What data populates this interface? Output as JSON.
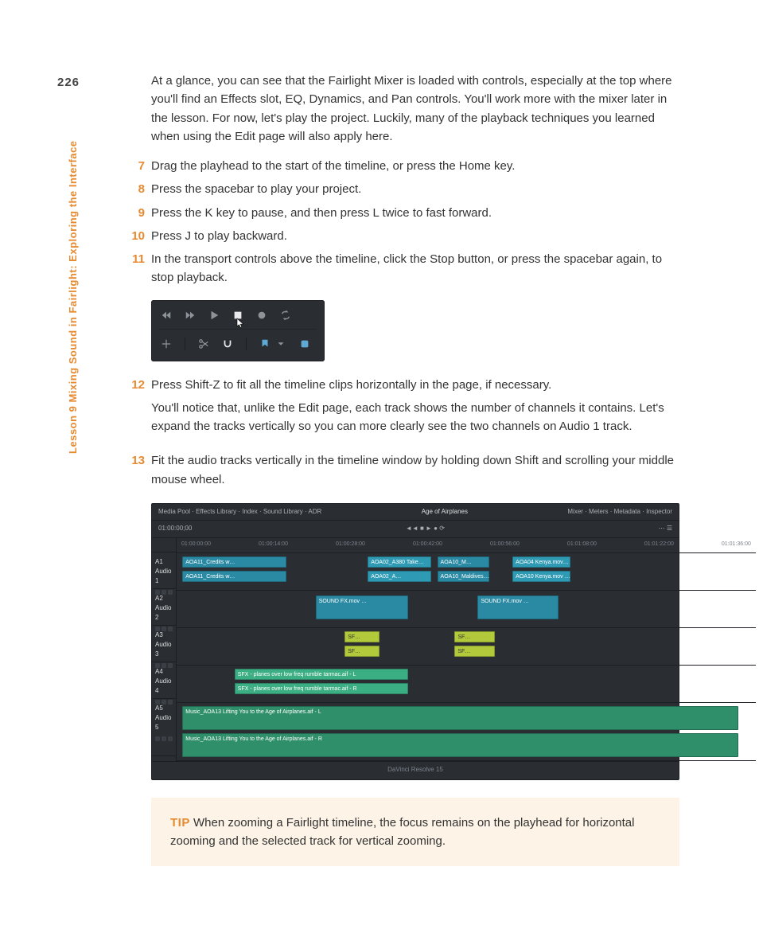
{
  "page_number": "226",
  "side_label": "Lesson 9   Mixing Sound in Fairlight: Exploring the Interface",
  "intro": "At a glance, you can see that the Fairlight Mixer is loaded with controls, especially at the top where you'll find an Effects slot, EQ, Dynamics, and Pan controls. You'll work more with the mixer later in the lesson. For now, let's play the project. Luckily, many of the playback techniques you learned when using the Edit page will also apply here.",
  "steps": {
    "s7": {
      "n": "7",
      "t": "Drag the playhead to the start of the timeline, or press the Home key."
    },
    "s8": {
      "n": "8",
      "t": "Press the spacebar to play your project."
    },
    "s9": {
      "n": "9",
      "t": "Press the K key to pause, and then press L twice to fast forward."
    },
    "s10": {
      "n": "10",
      "t": "Press J to play backward."
    },
    "s11": {
      "n": "11",
      "t": "In the transport controls above the timeline, click the Stop button, or press the spacebar again, to stop playback."
    },
    "s12": {
      "n": "12",
      "t": "Press Shift-Z to fit all the timeline clips horizontally in the page, if necessary."
    },
    "s12after": "You'll notice that, unlike the Edit page, each track shows the number of channels it contains. Let's expand the tracks vertically so you can more clearly see the two channels on Audio 1 track.",
    "s13": {
      "n": "13",
      "t": "Fit the audio tracks vertically in the timeline window by holding down Shift and scrolling your middle mouse wheel."
    }
  },
  "transport_icons": {
    "rewind": "rewind-icon",
    "ff": "fast-forward-icon",
    "play": "play-icon",
    "stop": "stop-icon",
    "record": "record-icon",
    "loop": "loop-icon",
    "crosshair": "crosshair-icon",
    "scissors": "scissors-icon",
    "magnet": "snap-icon",
    "flag": "marker-icon",
    "chev": "chevron-down-icon",
    "flagfill": "marker-fill-icon"
  },
  "timeline": {
    "title": "Age of Airplanes",
    "left_menu": "Media Pool  ·  Effects Library  ·  Index  ·  Sound Library  ·  ADR",
    "right_menu": "Mixer  ·  Meters  ·  Metadata  ·  Inspector",
    "timecode": "01:00:00;00",
    "tracks": {
      "a1": "A1   Audio 1",
      "a2": "A2   Audio 2",
      "a3": "A3   Audio 3",
      "a4": "A4   Audio 4",
      "a5": "A5   Audio 5"
    },
    "ruler": [
      "01:00:00:00",
      "01:00:14:00",
      "01:00:28:00",
      "01:00:42:00",
      "01:00:56:00",
      "01:01:08:00",
      "01:01:22:00",
      "01:01:36:00"
    ],
    "clips": {
      "c1": "AOA11_Credits w…",
      "c2": "AOA11_Credits w…",
      "c3": "AOA02_A380 Take…",
      "c4": "AOA02_A…",
      "c5": "AOA10_M…",
      "c6": "AOA10_Maldives…",
      "c7": "AOA04 Kenya.mov…",
      "c8": "AOA10 Kenya.mov …",
      "c9": "SOUND FX.mov …",
      "c10": "SOUND FX.mov …",
      "c11": "SF…",
      "c12": "SF…",
      "c13": "SF…",
      "c14": "SF…",
      "c15": "SFX - planes over low freq rumble tarmac.aif - L",
      "c16": "SFX - planes over low freq rumble tarmac.aif - R",
      "c17": "Music_AOA13 Lifting You to the Age of Airplanes.aif - L",
      "c18": "Music_AOA13 Lifting You to the Age of Airplanes.aif - R"
    },
    "footer": "DaVinci Resolve 15"
  },
  "tip": {
    "label": "TIP",
    "text": "  When zooming a Fairlight timeline, the focus remains on the playhead for horizontal zooming and the selected track for vertical zooming."
  }
}
